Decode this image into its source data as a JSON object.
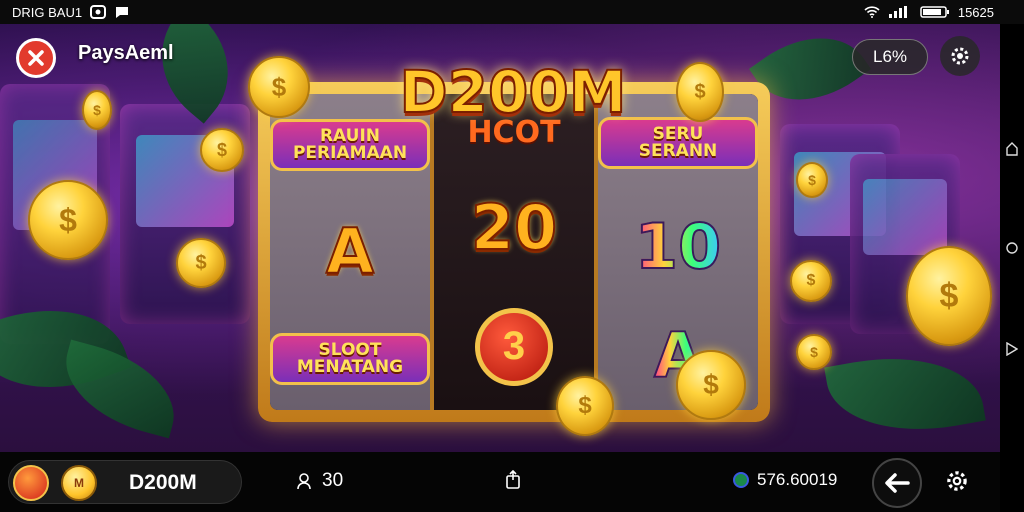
{
  "status_bar": {
    "carrier": "DRIG BAU1",
    "time": "15625"
  },
  "header": {
    "title": "PaysAeml",
    "percent": "L6%"
  },
  "banner": "D200M",
  "reels": [
    {
      "symbols": [
        "RAUIN PERIAMAAN",
        "A",
        "SLOOT MENATANG"
      ]
    },
    {
      "symbols": [
        "HCOT",
        "20",
        "3"
      ]
    },
    {
      "symbols": [
        "SERU SERANN",
        "10",
        "A"
      ]
    }
  ],
  "bottom_bar": {
    "label": "D200M",
    "players": "30",
    "balance": "576.60019"
  },
  "colors": {
    "accent": "#ffc62a",
    "close": "#e23a2d",
    "frame": "#f6cc5a"
  }
}
